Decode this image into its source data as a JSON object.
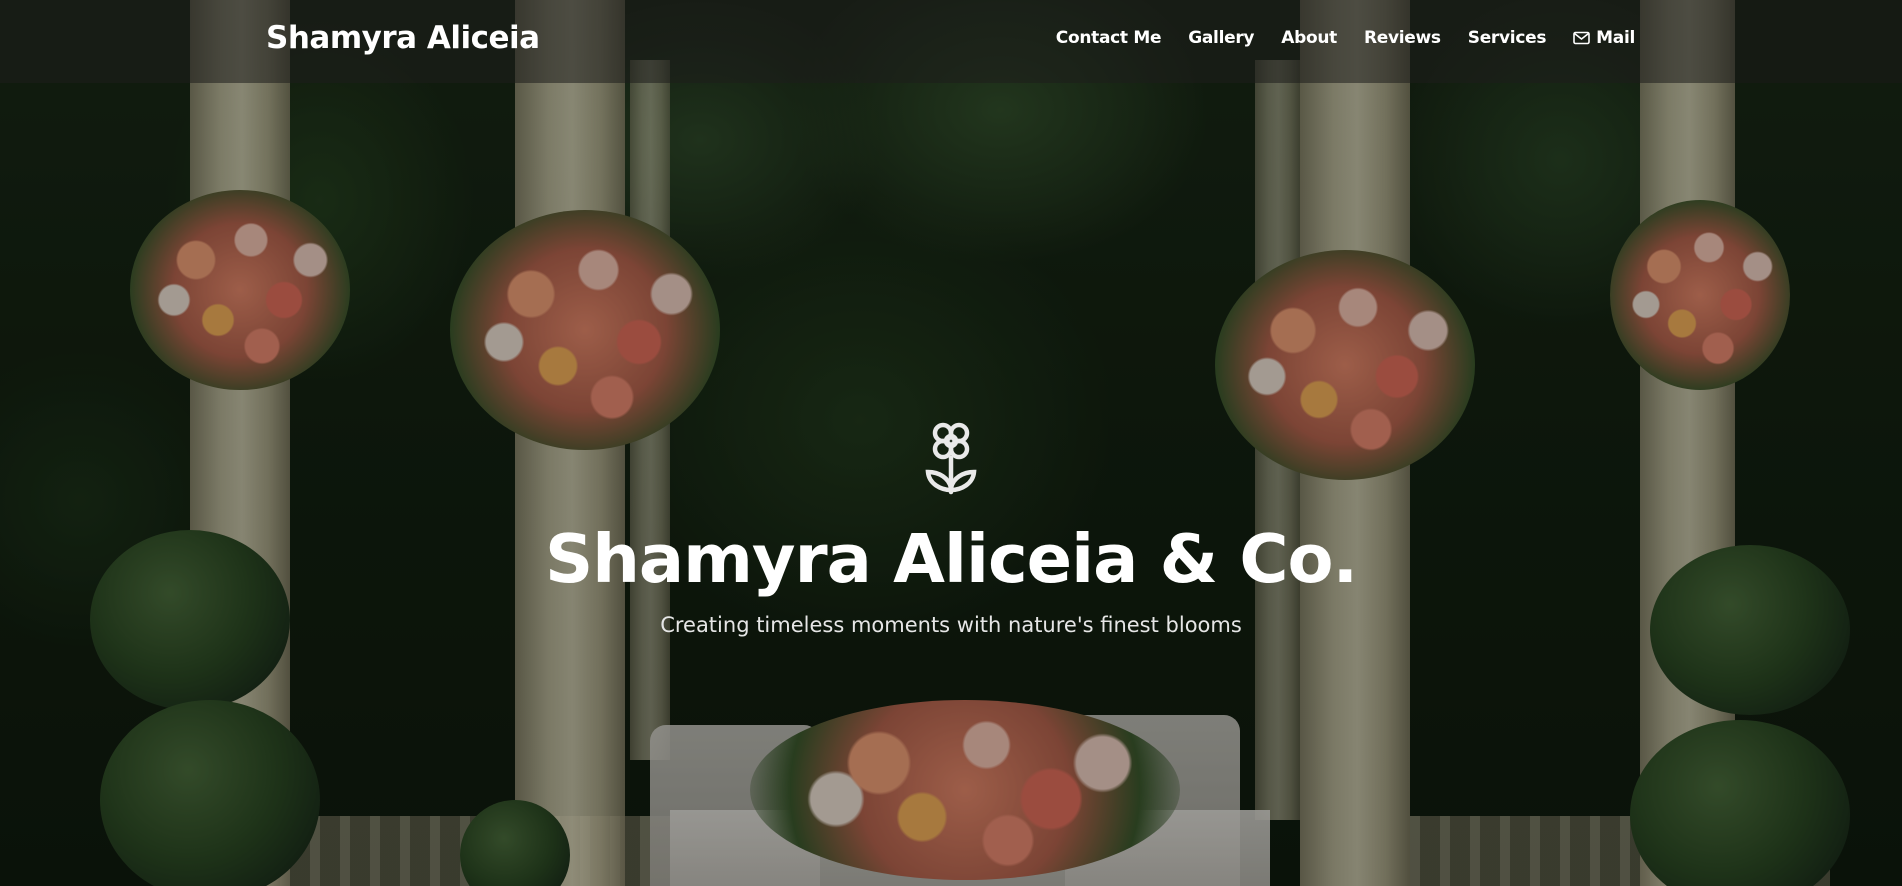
{
  "navbar": {
    "brand": "Shamyra Aliceia",
    "links": [
      {
        "label": "Contact Me"
      },
      {
        "label": "Gallery"
      },
      {
        "label": "About"
      },
      {
        "label": "Reviews"
      },
      {
        "label": "Services"
      },
      {
        "label": "Mail",
        "icon": "envelope-icon"
      }
    ]
  },
  "hero": {
    "icon": "flower-icon",
    "title": "Shamyra Aliceia & Co.",
    "subtitle": "Creating timeless moments with nature's finest blooms"
  },
  "colors": {
    "text": "#ffffff",
    "navbar_bg": "rgba(30,30,28,0.55)",
    "foliage": "#223a1d",
    "pillar": "#eee8c9"
  }
}
